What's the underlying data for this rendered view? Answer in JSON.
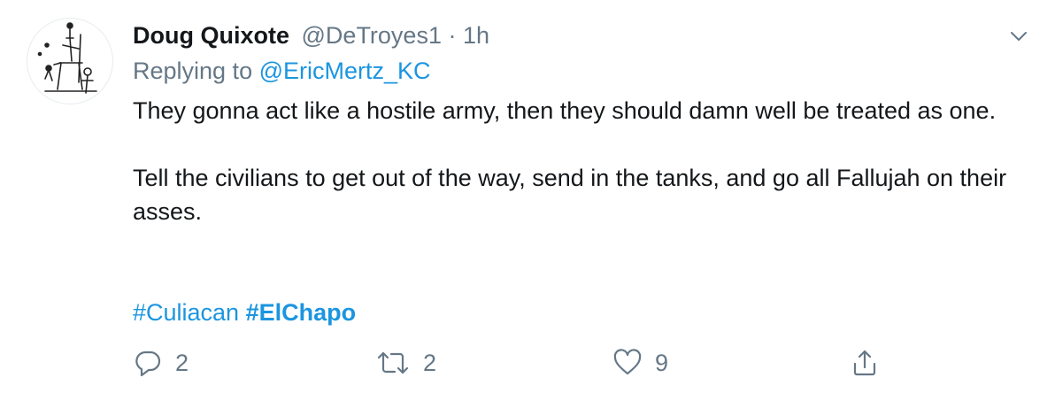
{
  "tweet": {
    "display_name": "Doug Quixote",
    "handle": "@DeTroyes1",
    "separator": "·",
    "time": "1h",
    "replying_label": "Replying to",
    "replying_handle": "@EricMertz_KC",
    "paragraph1": "They gonna act like a hostile army, then they should damn well be treated as one.",
    "paragraph2": "Tell the civilians to get out of the way, send in the tanks, and go all Fallujah on their asses.",
    "hashtags": [
      "#Culiacan",
      "#ElChapo"
    ]
  },
  "actions": {
    "reply_count": "2",
    "retweet_count": "2",
    "like_count": "9"
  },
  "icons": {
    "menu": "chevron-down-icon",
    "reply": "reply-icon",
    "retweet": "retweet-icon",
    "like": "heart-icon",
    "share": "share-icon"
  },
  "colors": {
    "link": "#1b95e0",
    "muted": "#657786",
    "text": "#14171a"
  }
}
